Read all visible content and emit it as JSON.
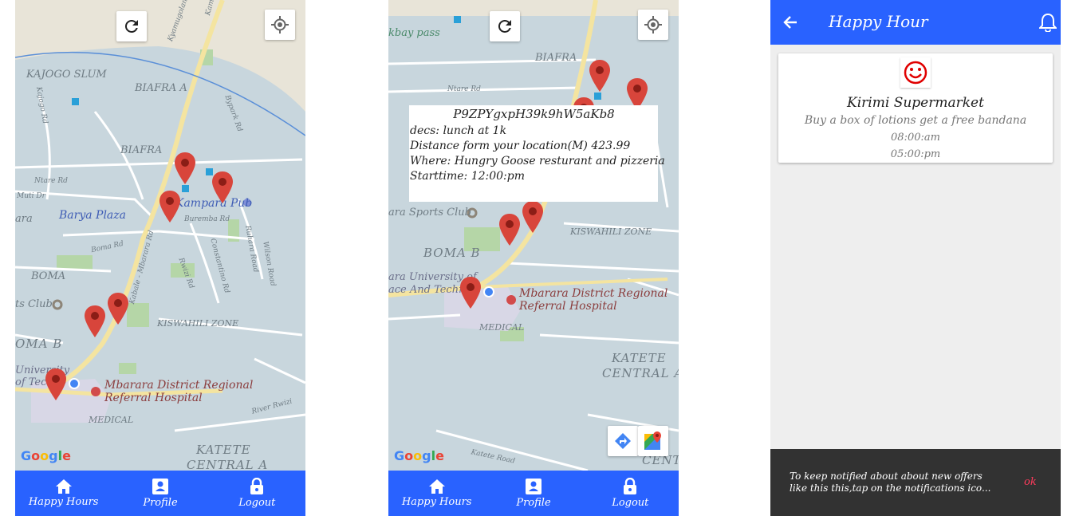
{
  "screen1": {
    "map_labels": {
      "kampala_rd": "Kampala Rd",
      "kyamugolani_rd": "Kyamugolani Rd",
      "kajogo_slum": "KAJOGO SLUM",
      "kajogo_rd": "Kajogo Rd",
      "biafra_a": "BIAFRA A",
      "bypark_rd": "Bypark Rd",
      "biafra": "BIAFRA",
      "ntare_rd": "Ntare Rd",
      "muti_dr": "Muti Dr",
      "barya_plaza": "Barya Plaza",
      "kampara_pub": "Kampara Pub",
      "buremba_rd": "Buremba Rd",
      "boma_rd": "Boma Rd",
      "mbarara_rd": "Kabale - Mbarara Rd",
      "rwizi_rd": "Rwizi Rd",
      "constantino_rd": "Constantino Rd",
      "ruhara_rd": "Ruhara Road",
      "wilson_rd": "Wilson Road",
      "boma": "BOMA",
      "sports_club": "ts Club",
      "kiswahili": "KISWAHILI ZONE",
      "boma_b": "OMA B",
      "university": "University of Techno",
      "hospital": "Mbarara District Regional Referral Hospital",
      "hospital_line1": "Mbarara District Regional",
      "hospital_line2": "Referral Hospital",
      "medical": "MEDICAL",
      "river_rwizi": "River Rwizi",
      "katete": "KATETE",
      "central_a": "CENTRAL A",
      "ara": "ara"
    },
    "google_logo": "Google"
  },
  "screen2": {
    "map_labels": {
      "bypass": "kbay pass",
      "biafra": "BIAFRA",
      "ntare_rd": "Ntare Rd",
      "sports_club": "ara Sports Club",
      "kiswahili": "KISWAHILI ZONE",
      "boma_b": "BOMA B",
      "university_1": "ara University of",
      "university_2": "ace And Techno",
      "hospital_line1": "Mbarara District Regional",
      "hospital_line2": "Referral Hospital",
      "medical": "MEDICAL",
      "katete": "KATETE",
      "central_a": "CENTRAL A",
      "katete_rd": "Katete Road",
      "centr": "CENTR"
    },
    "info_window": {
      "code": "P9ZPYgxpH39k9hW5aKb8",
      "desc": "decs: lunch at 1k",
      "distance": "Distance form your location(M) 423.99",
      "where": "Where: Hungry Goose resturant and pizzeria",
      "starttime": "Starttime: 12:00:pm"
    },
    "google_logo": "Google"
  },
  "nav": {
    "items": [
      {
        "label": "Happy Hours",
        "icon": "home-icon"
      },
      {
        "label": "Profile",
        "icon": "profile-icon"
      },
      {
        "label": "Logout",
        "icon": "lock-icon"
      }
    ],
    "bg_color": "#2962ff"
  },
  "screen3": {
    "title": "Happy Hour",
    "card": {
      "name": "Kirimi Supermarket",
      "description": "Buy a box of lotions get a free bandana",
      "start_time": "08:00:am",
      "end_time": "05:00:pm"
    },
    "snackbar": {
      "message": "To keep notified about about new offers like this this,tap on the notifications ico...",
      "action": "ok"
    }
  }
}
